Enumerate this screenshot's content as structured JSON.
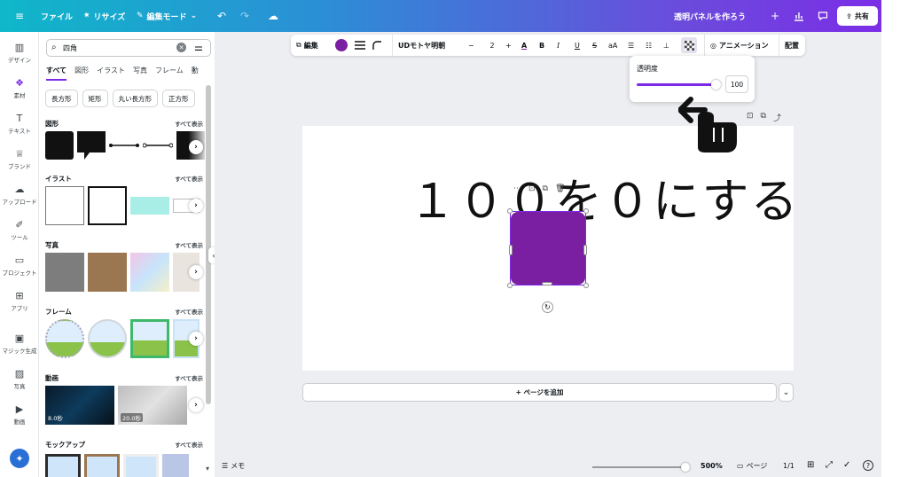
{
  "topbar": {
    "file_label": "ファイル",
    "resize_label": "リサイズ",
    "mode_label": "編集モード",
    "doc_title": "透明パネルを作ろう",
    "share_label": "共有"
  },
  "rail": {
    "items": [
      {
        "label": "デザイン",
        "icon": "layout-icon"
      },
      {
        "label": "素材",
        "icon": "elements-icon"
      },
      {
        "label": "テキスト",
        "icon": "text-icon"
      },
      {
        "label": "ブランド",
        "icon": "brand-icon"
      },
      {
        "label": "アップロード",
        "icon": "upload-icon"
      },
      {
        "label": "ツール",
        "icon": "draw-icon"
      },
      {
        "label": "プロジェクト",
        "icon": "folder-icon"
      },
      {
        "label": "アプリ",
        "icon": "apps-icon"
      },
      {
        "label": "マジック生成",
        "icon": "magic-media-icon"
      },
      {
        "label": "写真",
        "icon": "photo-icon"
      },
      {
        "label": "動画",
        "icon": "video-icon"
      }
    ]
  },
  "panel": {
    "search_value": "四角",
    "filter_tabs": [
      "すべて",
      "図形",
      "イラスト",
      "写真",
      "フレーム",
      "動"
    ],
    "chips": [
      "長方形",
      "矩形",
      "丸い長方形",
      "正方形"
    ],
    "see_all": "すべて表示",
    "sections": {
      "shapes": "図形",
      "illustrations": "イラスト",
      "photos": "写真",
      "frames": "フレーム",
      "videos": "動画",
      "mockups": "モックアップ"
    },
    "video_durations": [
      "8.0秒",
      "20.0秒"
    ]
  },
  "toolbar": {
    "edit_label": "編集",
    "fill_color": "#7b1fa2",
    "font_name": "UDモトヤ明朝",
    "font_size": "2",
    "animation_label": "アニメーション",
    "position_label": "配置"
  },
  "transparency": {
    "label": "透明度",
    "value": "100",
    "level": 1.0
  },
  "canvas": {
    "headline": "１００を０にする",
    "shape_color": "#7b1fa2"
  },
  "add_page_label": "+ ページを追加",
  "footer": {
    "notes_label": "メモ",
    "zoom": "500%",
    "pages_label": "ページ",
    "page_count": "1/1"
  },
  "colors": {
    "accent": "#7d2ae8",
    "panel_bg": "#eceef1"
  }
}
